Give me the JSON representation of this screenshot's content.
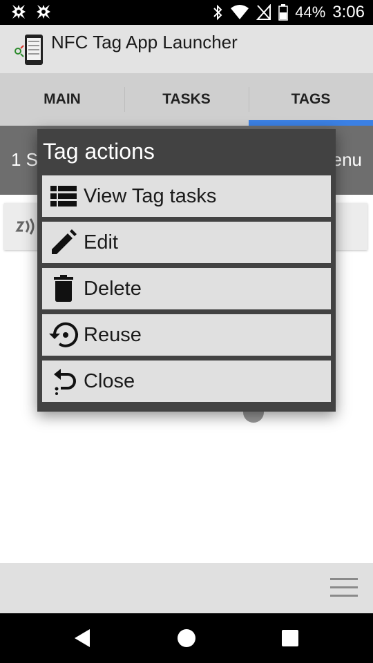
{
  "status_bar": {
    "battery_percent": "44%",
    "time": "3:06",
    "left_icons": [
      "notification-icon",
      "notification-icon"
    ],
    "right_icons": [
      "bluetooth-icon",
      "wifi-icon",
      "no-sim-icon",
      "battery-icon"
    ]
  },
  "app": {
    "title": "NFC Tag App Launcher",
    "logo_icon": "app-logo-icon"
  },
  "tabs": [
    {
      "label": "MAIN",
      "active": false
    },
    {
      "label": "TASKS",
      "active": false
    },
    {
      "label": "TAGS",
      "active": true
    }
  ],
  "subheader": {
    "left_text": "1 S",
    "right_text": "enu"
  },
  "dialog": {
    "title": "Tag actions",
    "items": [
      {
        "label": "View Tag tasks",
        "icon": "list-icon"
      },
      {
        "label": "Edit",
        "icon": "pencil-icon"
      },
      {
        "label": "Delete",
        "icon": "trash-icon"
      },
      {
        "label": "Reuse",
        "icon": "restore-icon"
      },
      {
        "label": "Close",
        "icon": "undo-icon"
      }
    ]
  },
  "colors": {
    "tab_indicator": "#3b80e4",
    "dialog_background": "#424242",
    "item_background": "#e0e0e0"
  }
}
